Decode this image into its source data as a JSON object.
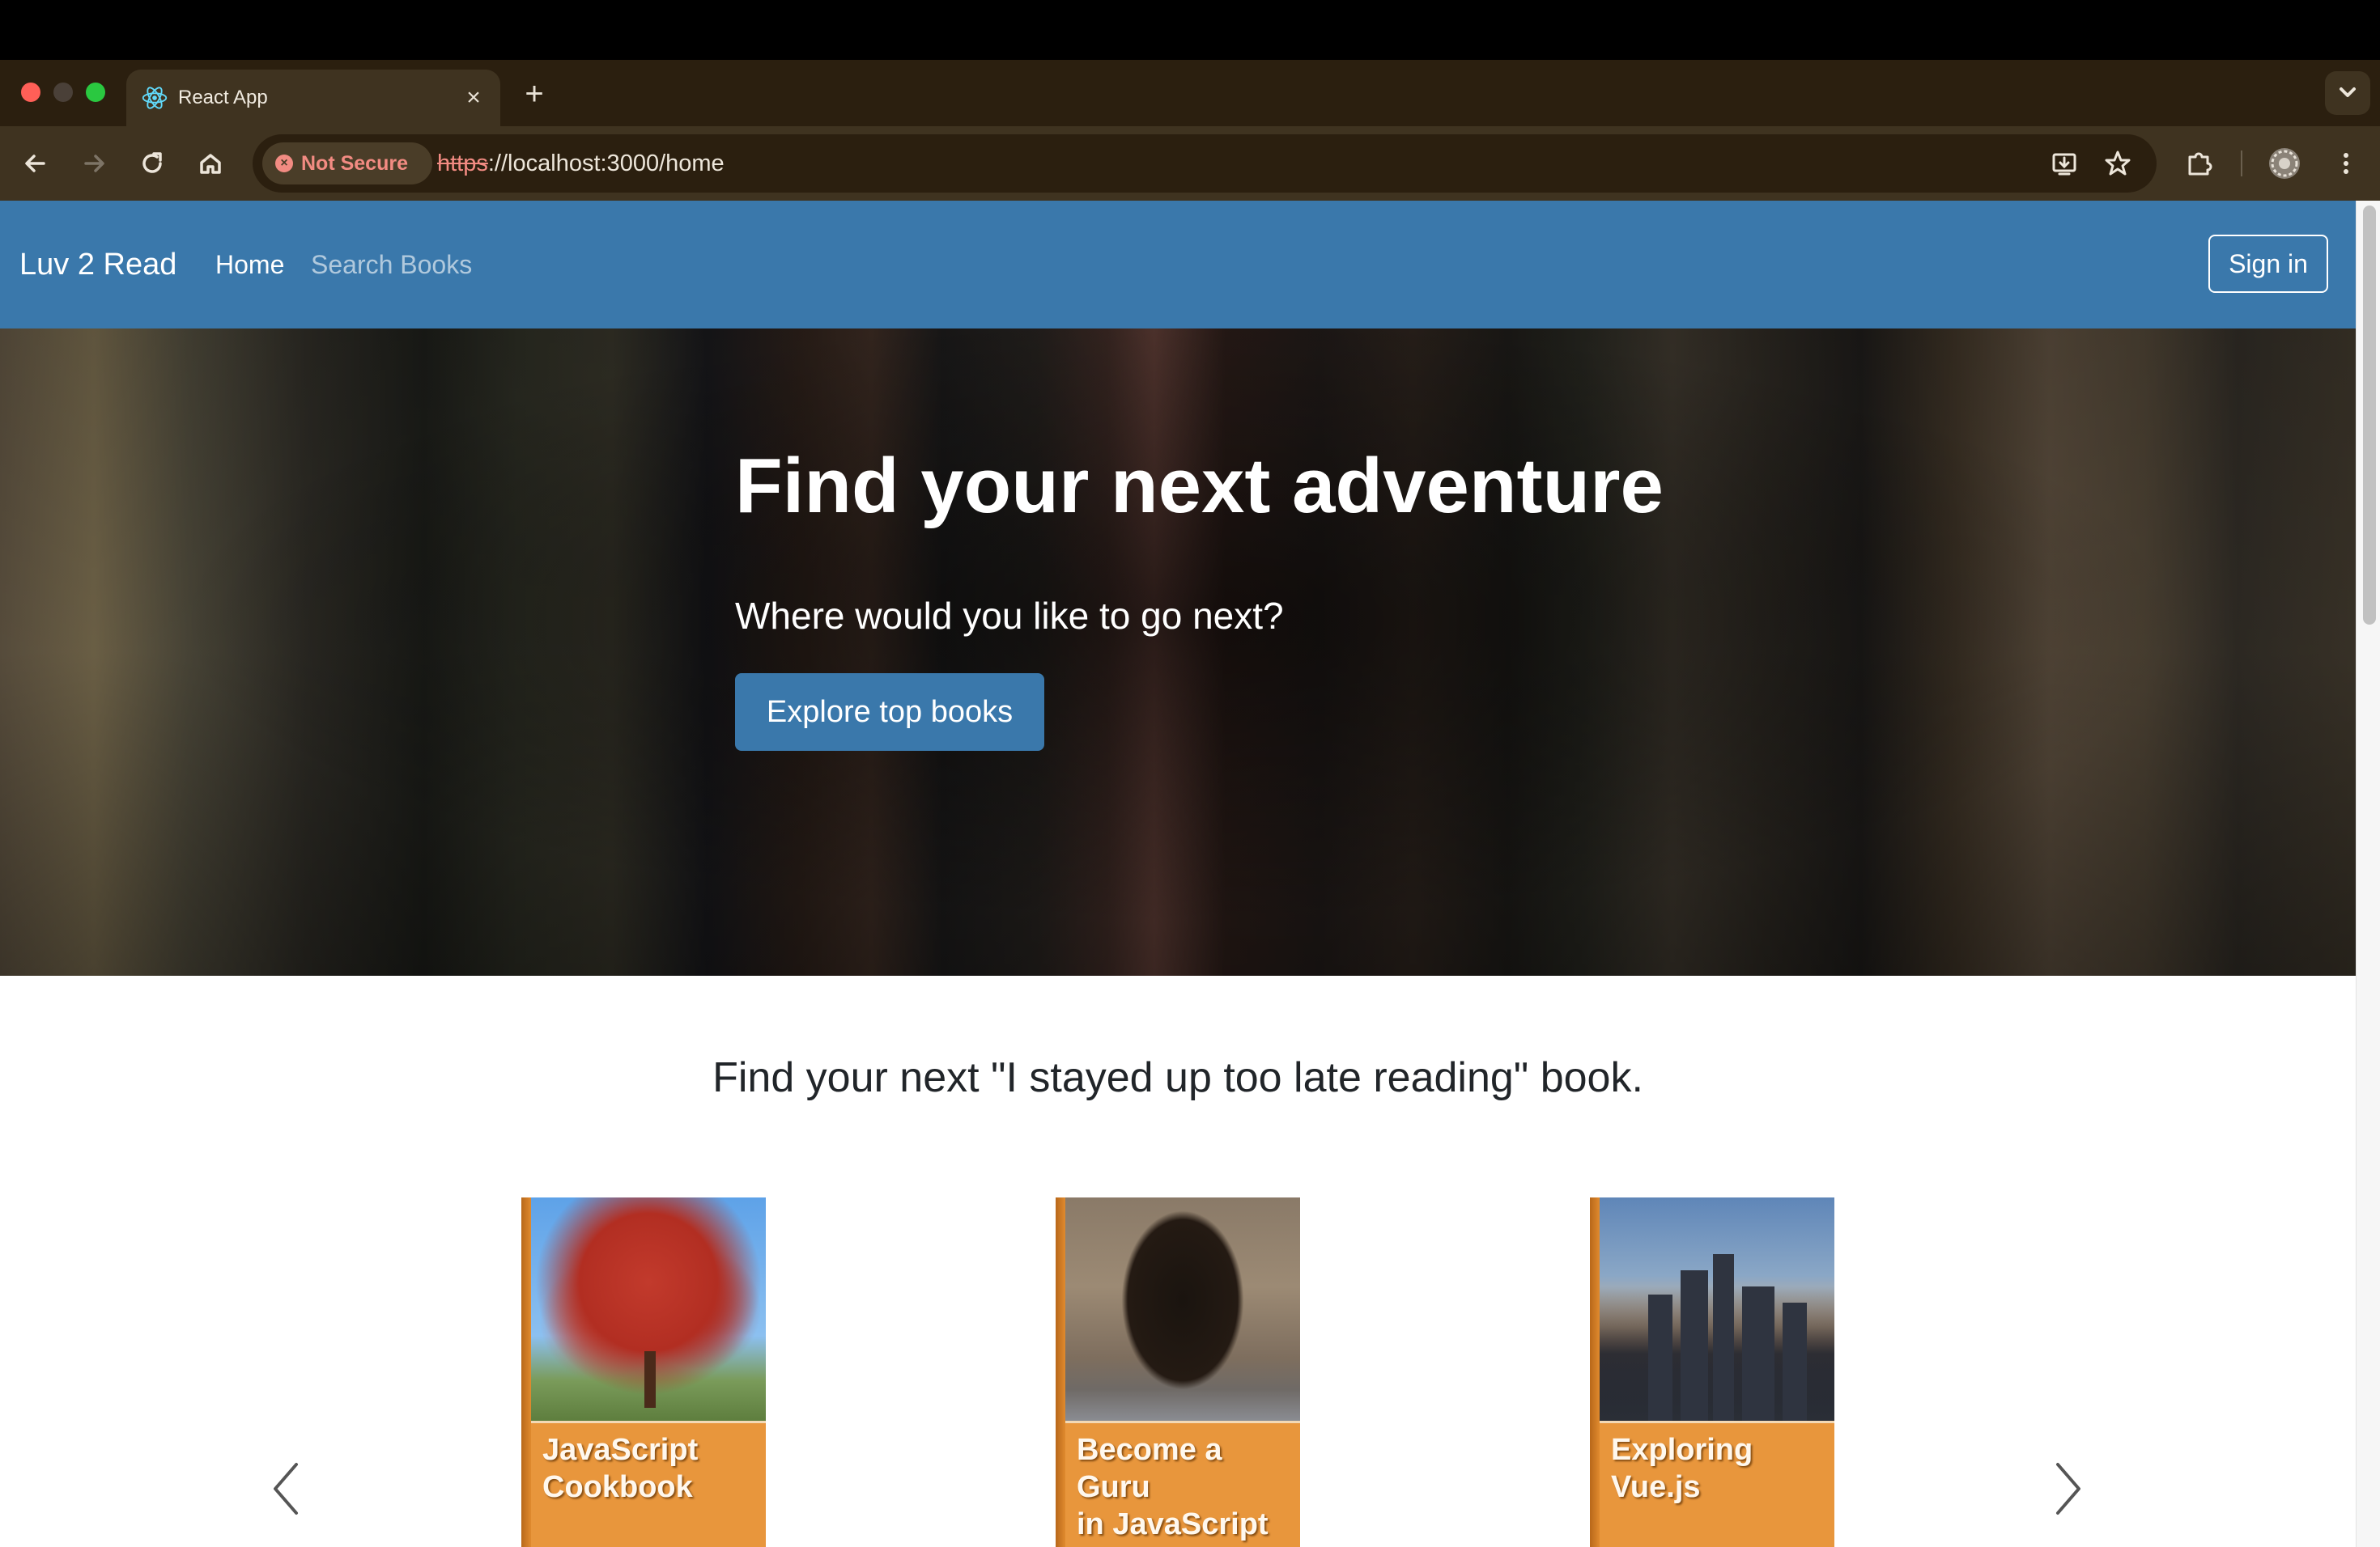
{
  "browser": {
    "tab_title": "React App",
    "security_label": "Not Secure",
    "url_scheme": "https",
    "url_rest": "://localhost:3000/home"
  },
  "navbar": {
    "brand": "Luv 2 Read",
    "links": [
      "Home",
      "Search Books"
    ],
    "sign_in": "Sign in"
  },
  "hero": {
    "title": "Find your next adventure",
    "subtitle": "Where would you like to go next?",
    "button": "Explore top books"
  },
  "carousel": {
    "title": "Find your next \"I stayed up too late reading\" book.",
    "books": [
      {
        "title_line1": "JavaScript",
        "title_line2": "Cookbook"
      },
      {
        "title_line1": "Become a Guru",
        "title_line2": "in JavaScript"
      },
      {
        "title_line1": "Exploring",
        "title_line2": "Vue.js"
      }
    ]
  },
  "colors": {
    "navbar": "#3a78ab",
    "primary_button": "#3a78ab",
    "book_band": "#e8963c",
    "not_secure": "#f28b82"
  },
  "icons": [
    "react-icon",
    "close-icon",
    "plus-icon",
    "chevron-down-icon",
    "back-arrow-icon",
    "forward-arrow-icon",
    "reload-icon",
    "home-icon",
    "install-icon",
    "star-icon",
    "extensions-icon",
    "profile-avatar-icon",
    "kebab-menu-icon",
    "chevron-left-icon",
    "chevron-right-icon"
  ]
}
